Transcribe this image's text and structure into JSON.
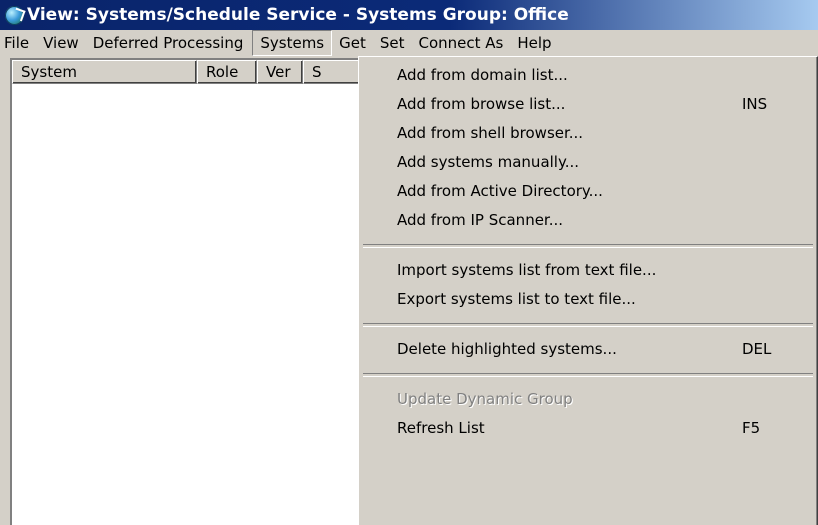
{
  "window": {
    "title": "View: Systems/Schedule Service - Systems Group: Office"
  },
  "menubar": {
    "items": [
      {
        "label": "File"
      },
      {
        "label": "View"
      },
      {
        "label": "Deferred Processing"
      },
      {
        "label": "Systems"
      },
      {
        "label": "Get"
      },
      {
        "label": "Set"
      },
      {
        "label": "Connect As"
      },
      {
        "label": "Help"
      }
    ]
  },
  "list": {
    "columns": [
      {
        "label": "System"
      },
      {
        "label": "Role"
      },
      {
        "label": "Ver"
      },
      {
        "label": "S"
      }
    ]
  },
  "systems_menu": {
    "group1": [
      {
        "label": "Add from domain list..."
      },
      {
        "label": "Add from browse list...",
        "shortcut": "INS"
      },
      {
        "label": "Add from shell browser..."
      },
      {
        "label": "Add systems manually..."
      },
      {
        "label": "Add from Active Directory..."
      },
      {
        "label": "Add from IP Scanner..."
      }
    ],
    "group2": [
      {
        "label": "Import systems list from text file..."
      },
      {
        "label": "Export systems list to text file..."
      }
    ],
    "group3": [
      {
        "label": "Delete highlighted systems...",
        "shortcut": "DEL"
      }
    ],
    "group4": [
      {
        "label": "Update Dynamic Group",
        "disabled": true
      },
      {
        "label": "Refresh List",
        "shortcut": "F5"
      }
    ]
  }
}
